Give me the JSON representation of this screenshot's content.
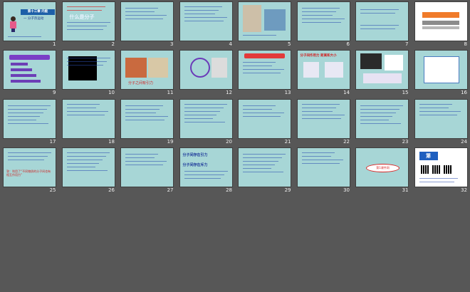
{
  "slides": [
    {
      "number": "1",
      "style": "title"
    },
    {
      "number": "2",
      "style": "text"
    },
    {
      "number": "3",
      "style": "text"
    },
    {
      "number": "4",
      "style": "text"
    },
    {
      "number": "5",
      "style": "photo"
    },
    {
      "number": "6",
      "style": "text"
    },
    {
      "number": "7",
      "style": "text"
    },
    {
      "number": "8",
      "style": "white-bars"
    },
    {
      "number": "9",
      "style": "text"
    },
    {
      "number": "10",
      "style": "black"
    },
    {
      "number": "11",
      "style": "photo"
    },
    {
      "number": "12",
      "style": "diagram"
    },
    {
      "number": "13",
      "style": "diagram"
    },
    {
      "number": "14",
      "style": "diagram"
    },
    {
      "number": "15",
      "style": "diagram"
    },
    {
      "number": "16",
      "style": "white-frame"
    },
    {
      "number": "17",
      "style": "text"
    },
    {
      "number": "18",
      "style": "text"
    },
    {
      "number": "19",
      "style": "text"
    },
    {
      "number": "20",
      "style": "text"
    },
    {
      "number": "21",
      "style": "text"
    },
    {
      "number": "22",
      "style": "text"
    },
    {
      "number": "23",
      "style": "text"
    },
    {
      "number": "24",
      "style": "text"
    },
    {
      "number": "25",
      "style": "text"
    },
    {
      "number": "26",
      "style": "text"
    },
    {
      "number": "27",
      "style": "text"
    },
    {
      "number": "28",
      "style": "text"
    },
    {
      "number": "29",
      "style": "text"
    },
    {
      "number": "30",
      "style": "text"
    },
    {
      "number": "31",
      "style": "title"
    },
    {
      "number": "32",
      "style": "ppt-ad"
    }
  ],
  "slide_text": {
    "s1_title": "第十三章 内能",
    "s1_sub": "一 分子热运动",
    "s2_heading": "什么是分子",
    "s10_caption": "分子之间有引力",
    "s14_title": "分子间作用力 距离和大小",
    "s25_red": "答：利用了“不同物质的分子间也有相互作用力”",
    "s28_a": "分子间存在引力",
    "s28_b": "分子间存在斥力",
    "s31_oval": "第1课件网",
    "s32_logo": "第1PPT"
  }
}
